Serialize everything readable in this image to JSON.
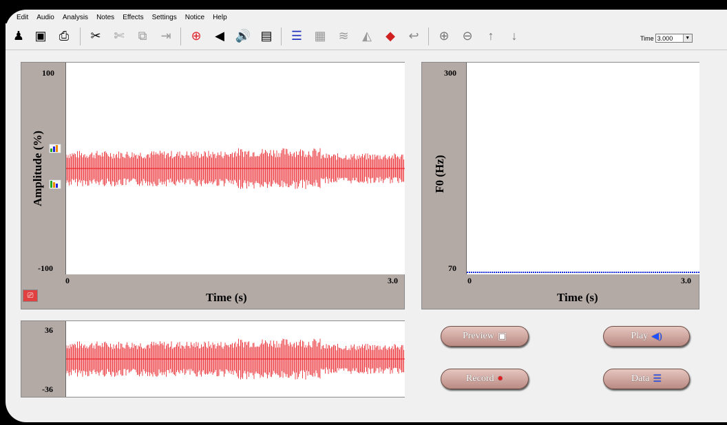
{
  "menu": [
    "Edit",
    "Audio",
    "Analysis",
    "Notes",
    "Effects",
    "Settings",
    "Notice",
    "Help"
  ],
  "toolbar": {
    "icons": [
      "person-icon",
      "save-icon",
      "print-icon",
      "cut-icon",
      "scissors-icon",
      "copy-icon",
      "paste-icon",
      "record-icon",
      "speaker-icon",
      "volume-icon",
      "display-icon",
      "data-icon",
      "spectrum-icon",
      "filter-icon",
      "landscape-icon",
      "diamond-icon",
      "back-icon",
      "zoom-in-icon",
      "zoom-out-icon",
      "up-arrow-icon",
      "down-arrow-icon"
    ],
    "time_label": "Time",
    "time_value": "3.000",
    "time_arrow": "▼"
  },
  "amplitude_panel": {
    "ylabel": "Amplitude (%)",
    "ymax": "100",
    "ymin": "-100",
    "xmin": "0",
    "xmax": "3.0",
    "xlabel": "Time (s)"
  },
  "f0_panel": {
    "ylabel": "F0 (Hz)",
    "ymax": "300",
    "ymin": "70",
    "xmin": "0",
    "xmax": "3.0",
    "xlabel": "Time (s)"
  },
  "mini_panel": {
    "ymax": "36",
    "ymin": "-36"
  },
  "buttons": {
    "preview": "Preview",
    "play": "Play",
    "record": "Record",
    "data": "Data"
  },
  "colors": {
    "waveform": "#e8151b",
    "f0_line": "#1a2bd6",
    "panel_bg": "#b3a9a5"
  }
}
